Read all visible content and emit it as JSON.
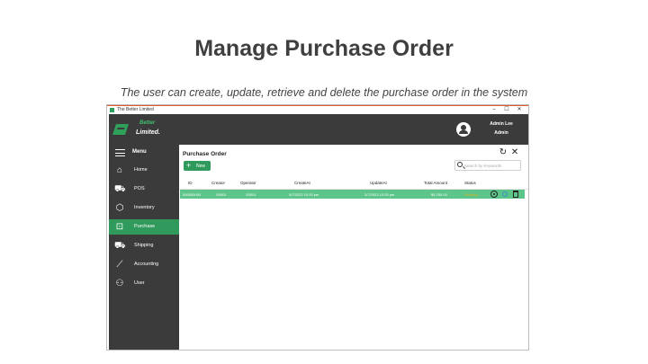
{
  "slide": {
    "title": "Manage Purchase Order",
    "subtitle": "The user can create, update, retrieve and delete the purchase order in the system"
  },
  "window": {
    "title": "The Better Limited",
    "controls": [
      "–",
      "☐",
      "✕"
    ]
  },
  "header": {
    "logo_top": "Better",
    "logo_bottom": "Limited.",
    "user_name": "Admin Lee",
    "user_role": "Admin"
  },
  "sidebar": {
    "menu_label": "Menu",
    "items": [
      {
        "label": "Home",
        "icon": "home-icon",
        "active": false
      },
      {
        "label": "POS",
        "icon": "cart-icon",
        "active": false
      },
      {
        "label": "Inventory",
        "icon": "box-icon",
        "active": false
      },
      {
        "label": "Purchase",
        "icon": "bag-icon",
        "active": true
      },
      {
        "label": "Shipping",
        "icon": "truck-icon",
        "active": false
      },
      {
        "label": "Accounting",
        "icon": "chart-icon",
        "active": false
      },
      {
        "label": "User",
        "icon": "users-icon",
        "active": false
      }
    ]
  },
  "main": {
    "heading": "Purchase Order",
    "new_label": "New",
    "search_placeholder": "Search by Keywords",
    "columns": [
      "ID",
      "Creator",
      "Operator",
      "CreateAt",
      "UpdateAt",
      "Total Amount",
      "Status"
    ],
    "rows": [
      {
        "id": "000000000",
        "creator": "S0001",
        "operator": "S0001",
        "create_at": "3/7/2022 10:33 pm",
        "update_at": "3/7/2022 10:33 pm",
        "total_amount": "$5,760.00",
        "status": "Pending"
      }
    ]
  },
  "colors": {
    "accent": "#2f9a5b",
    "row_highlight": "#5ec58a",
    "sidebar": "#3b3b3b",
    "status_pending": "#e0b416"
  }
}
